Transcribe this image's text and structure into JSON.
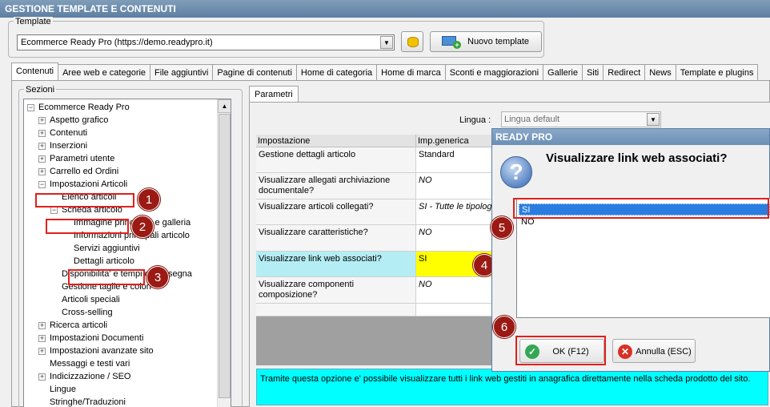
{
  "window": {
    "title": "GESTIONE TEMPLATE E CONTENUTI"
  },
  "template": {
    "label": "Template",
    "selected": "Ecommerce Ready Pro (https://demo.readypro.it)",
    "new_label": "Nuovo template"
  },
  "tabs": [
    "Contenuti",
    "Aree web e categorie",
    "File aggiuntivi",
    "Pagine di contenuti",
    "Home di categoria",
    "Home di marca",
    "Sconti e maggiorazioni",
    "Gallerie",
    "Siti",
    "Redirect",
    "News",
    "Template e plugins"
  ],
  "sezioni": {
    "label": "Sezioni",
    "nodes": [
      {
        "label": "Ecommerce Ready Pro",
        "exp": "−"
      },
      {
        "label": "Aspetto grafico",
        "exp": "+"
      },
      {
        "label": "Contenuti",
        "exp": "+"
      },
      {
        "label": "Inserzioni",
        "exp": "+"
      },
      {
        "label": "Parametri utente",
        "exp": "+"
      },
      {
        "label": "Carrello ed Ordini",
        "exp": "+"
      },
      {
        "label": "Impostazioni Articoli",
        "exp": "−"
      },
      {
        "label": "Elenco articoli",
        "exp": ""
      },
      {
        "label": "Scheda articolo",
        "exp": "−"
      },
      {
        "label": "Immagine principale e galleria",
        "exp": ""
      },
      {
        "label": "Informazioni principali articolo",
        "exp": ""
      },
      {
        "label": "Servizi aggiuntivi",
        "exp": ""
      },
      {
        "label": "Dettagli articolo",
        "exp": ""
      },
      {
        "label": "Disponibilita' e tempi di consegna",
        "exp": ""
      },
      {
        "label": "Gestione taglie e colori",
        "exp": ""
      },
      {
        "label": "Articoli speciali",
        "exp": ""
      },
      {
        "label": "Cross-selling",
        "exp": ""
      },
      {
        "label": "Ricerca articoli",
        "exp": "+"
      },
      {
        "label": "Impostazioni Documenti",
        "exp": "+"
      },
      {
        "label": "Impostazioni avanzate sito",
        "exp": "+"
      },
      {
        "label": "Messaggi e testi vari",
        "exp": ""
      },
      {
        "label": "Indicizzazione / SEO",
        "exp": "+"
      },
      {
        "label": "Lingue",
        "exp": ""
      },
      {
        "label": "Stringhe/Traduzioni",
        "exp": ""
      }
    ]
  },
  "params": {
    "tab": "Parametri",
    "lingua_label": "Lingua :",
    "lingua_value": "Lingua default",
    "col_impostazione": "Impostazione",
    "col_generica": "Imp.generica",
    "rows": [
      {
        "key": "Gestione dettagli articolo",
        "value": "Standard"
      },
      {
        "key": "Visualizzare allegati archiviazione documentale?",
        "value": "NO"
      },
      {
        "key": "Visualizzare articoli collegati?",
        "value": "SI - Tutte le tipologie"
      },
      {
        "key": "Visualizzare caratteristiche?",
        "value": "NO"
      },
      {
        "key": "Visualizzare link web associati?",
        "value": "SI"
      },
      {
        "key": "Visualizzare componenti composizione?",
        "value": "NO"
      }
    ],
    "info": "Tramite questa opzione e' possibile visualizzare tutti i link web gestiti in anagrafica direttamente nella scheda prodotto del sito."
  },
  "dialog": {
    "title": "READY PRO",
    "question": "Visualizzare link web associati?",
    "options": [
      "SI",
      "NO"
    ],
    "ok_label": "OK (F12)",
    "cancel_label": "Annulla (ESC)"
  },
  "markers": [
    "1",
    "2",
    "3",
    "4",
    "5",
    "6"
  ],
  "colors": {
    "marker": "#9b1a14",
    "highlight_box": "#e0201c",
    "info_bg": "#00ffff",
    "selected_row": "#b4eef4",
    "selected_value": "#ffff00",
    "list_selection": "#2a7de0"
  }
}
